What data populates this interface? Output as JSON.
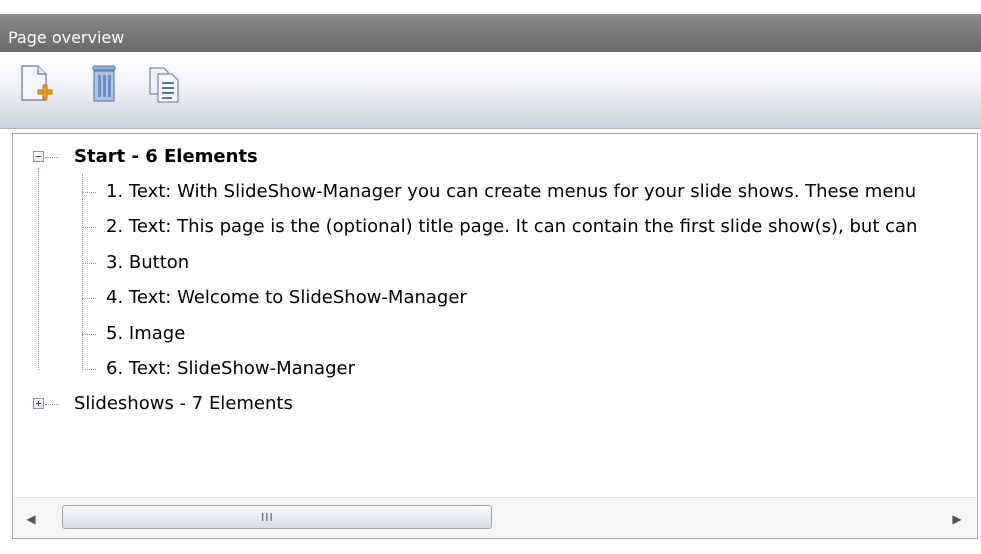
{
  "panel": {
    "title": "Page overview"
  },
  "toolbar": {
    "buttons": [
      {
        "name": "add-page",
        "icon": "new-page-plus-icon"
      },
      {
        "name": "delete",
        "icon": "trash-icon"
      },
      {
        "name": "duplicate",
        "icon": "copy-pages-icon"
      }
    ]
  },
  "tree": {
    "nodes": [
      {
        "label": "Start - 6 Elements",
        "expanded": true,
        "bold": true,
        "children": [
          "1. Text: With SlideShow-Manager you can create menus for your slide shows. These menu",
          "2. Text: This page is the (optional) title page. It can contain the first slide show(s), but can",
          "3. Button",
          "4. Text: Welcome to SlideShow-Manager",
          "5. Image",
          "6. Text: SlideShow-Manager"
        ]
      },
      {
        "label": "Slideshows - 7 Elements",
        "expanded": false,
        "bold": false
      }
    ]
  },
  "scrollbar": {
    "grip": "III"
  },
  "colors": {
    "titlebar": "#7a7a7a",
    "title_text": "#ffffff",
    "tree_border": "#a8a8a8",
    "expander_sign": "#233c6b"
  }
}
